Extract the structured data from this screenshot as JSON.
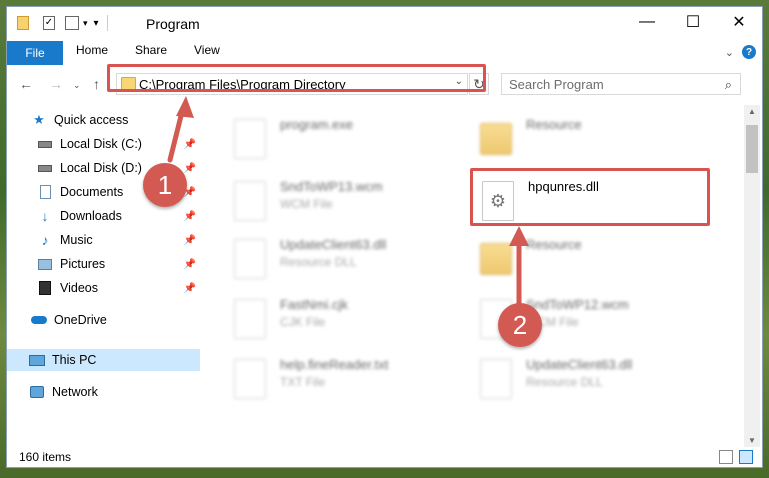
{
  "window": {
    "title": "Program"
  },
  "ribbon": {
    "tabs": [
      "File",
      "Home",
      "Share",
      "View"
    ],
    "help": "?"
  },
  "address": {
    "path": "C:\\Program Files\\Program Directory"
  },
  "search": {
    "placeholder": "Search Program"
  },
  "sidebar": {
    "items": [
      {
        "label": "Quick access",
        "icon": "star-icon"
      },
      {
        "label": "Local Disk (C:)",
        "icon": "drive-icon",
        "pinned": true
      },
      {
        "label": "Local Disk (D:)",
        "icon": "drive-icon",
        "pinned": true
      },
      {
        "label": "Documents",
        "icon": "documents-icon",
        "pinned": true
      },
      {
        "label": "Downloads",
        "icon": "download-icon",
        "pinned": true
      },
      {
        "label": "Music",
        "icon": "music-icon",
        "pinned": true
      },
      {
        "label": "Pictures",
        "icon": "pictures-icon",
        "pinned": true
      },
      {
        "label": "Videos",
        "icon": "videos-icon",
        "pinned": true
      },
      {
        "label": "OneDrive",
        "icon": "onedrive-icon"
      },
      {
        "label": "This PC",
        "icon": "pc-icon",
        "selected": true
      },
      {
        "label": "Network",
        "icon": "network-icon"
      }
    ]
  },
  "files": [
    {
      "name": "program.exe",
      "type": "",
      "icon": "exe"
    },
    {
      "name": "Resource",
      "type": "",
      "icon": "folder"
    },
    {
      "name": "SndToWP13.wcm",
      "type": "WCM File",
      "icon": "doc"
    },
    {
      "name": "hpqunres.dll",
      "type": "",
      "icon": "dll",
      "highlight": true
    },
    {
      "name": "UpdateClient63.dll",
      "type": "Resource DLL",
      "icon": "dll"
    },
    {
      "name": "Resource",
      "type": "",
      "icon": "folder"
    },
    {
      "name": "FastNmi.cjk",
      "type": "CJK File",
      "icon": "doc"
    },
    {
      "name": "SndToWP12.wcm",
      "type": "WCM File",
      "icon": "doc"
    },
    {
      "name": "help.fineReader.txt",
      "type": "TXT File",
      "icon": "doc"
    },
    {
      "name": "UpdateClient63.dll",
      "type": "Resource DLL",
      "icon": "dll"
    }
  ],
  "status": {
    "count": "160 items"
  },
  "annotations": {
    "step1": "1",
    "step2": "2"
  },
  "colors": {
    "accent": "#1979ca",
    "highlight": "#d9534f",
    "selection": "#cce8ff"
  }
}
